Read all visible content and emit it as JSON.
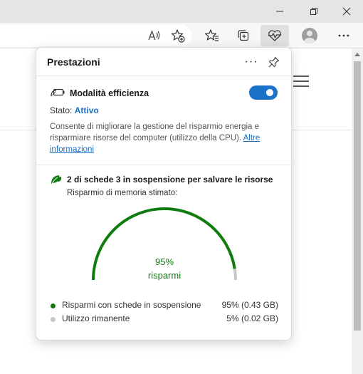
{
  "colors": {
    "accent": "#1a73c9",
    "saved": "#107c10",
    "remaining": "#c8c8c8"
  },
  "toolbar": {
    "icons": [
      "read-aloud-icon",
      "add-favorite-icon",
      "favorites-icon",
      "collections-icon",
      "performance-icon",
      "profile-icon",
      "more-icon"
    ]
  },
  "panel": {
    "title": "Prestazioni",
    "more_glyph": "···",
    "efficiency": {
      "label": "Modalità efficienza",
      "enabled": true,
      "status_label": "Stato:",
      "status_value": "Attivo",
      "description": "Consente di migliorare la gestione del risparmio energia e risparmiare risorse del computer (utilizzo della CPU). ",
      "link": "Altre informazioni"
    },
    "sleeping": {
      "message": "2 di schede 3 in sospensione per salvare le risorse",
      "memory_label": "Risparmio di memoria stimato:",
      "gauge_percent": "95%",
      "gauge_caption": "risparmi",
      "saved_fraction": 0.95,
      "legend": [
        {
          "name": "Risparmi con schede in sospensione",
          "value": "95% (0.43 GB)"
        },
        {
          "name": "Utilizzo rimanente",
          "value": "5% (0.02 GB)"
        }
      ]
    }
  }
}
